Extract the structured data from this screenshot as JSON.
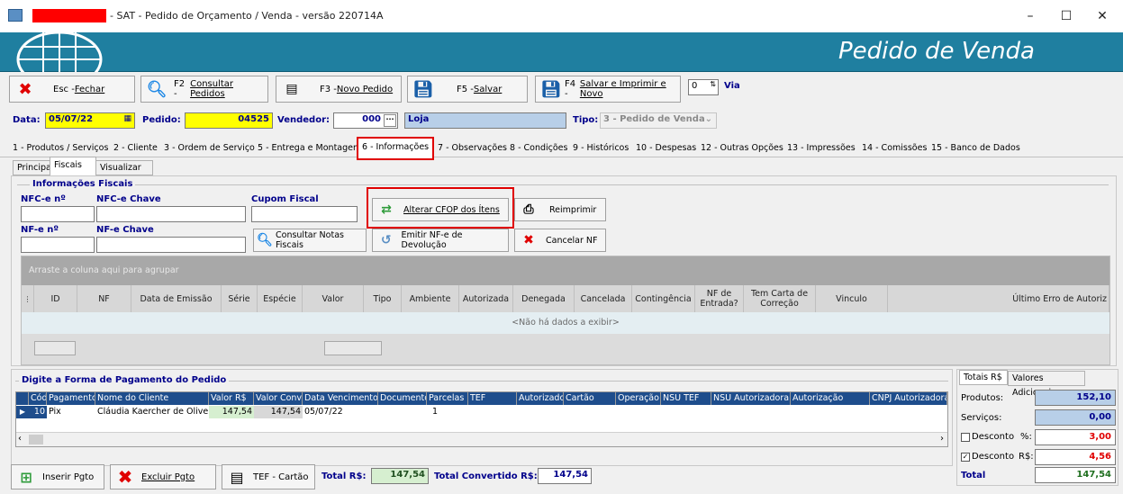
{
  "window": {
    "title": "- SAT - Pedido de Orçamento / Venda - versão 220714A",
    "controls": [
      "–",
      "☐",
      "✕"
    ]
  },
  "banner": {
    "title": "Pedido de Venda"
  },
  "toolbar": {
    "close": {
      "key": "Esc - ",
      "label": "Fechar"
    },
    "consult": {
      "key": "F2 - ",
      "label": "Consultar Pedidos"
    },
    "new": {
      "key": "F3 - ",
      "label": "Novo Pedido"
    },
    "save": {
      "key": "F5 - ",
      "label": "Salvar"
    },
    "save_print": {
      "key": "F4 - ",
      "label": "Salvar e Imprimir e Novo"
    },
    "via_value": "0",
    "via_label": "Via"
  },
  "header": {
    "data_label": "Data:",
    "data_value": "05/07/22",
    "pedido_label": "Pedido:",
    "pedido_value": "04525",
    "vendedor_label": "Vendedor:",
    "vendedor_code": "000",
    "vendedor_name": "Loja",
    "tipo_label": "Tipo:",
    "tipo_value": "3 - Pedido de Venda"
  },
  "tabs": [
    "1 - Produtos / Serviços",
    "2 - Cliente",
    "3 - Ordem de Serviço",
    "5 - Entrega e Montagem",
    "6 - Informações",
    "7 - Observações",
    "8 - Condições",
    "9 - Históricos",
    "10 - Despesas",
    "12 - Outras Opções",
    "13 - Impressões",
    "14 - Comissões",
    "15 - Banco de Dados"
  ],
  "subtabs": [
    "Principal",
    "Fiscais",
    "Visualizar XML"
  ],
  "fiscal": {
    "group_title": "Informações Fiscais",
    "nfce_num_label": "NFC-e nº",
    "nfce_key_label": "NFC-e Chave",
    "cupom_label": "Cupom Fiscal",
    "nfe_num_label": "NF-e nº",
    "nfe_key_label": "NF-e Chave",
    "btn_consult_nf": "Consultar Notas Fiscais",
    "btn_alter_cfop": "Alterar CFOP dos Ítens",
    "btn_reprint": "Reimprimir",
    "btn_devolution": "Emitir NF-e de Devolução",
    "btn_cancel_nf": "Cancelar NF"
  },
  "grid": {
    "group_hint": "Arraste a coluna aqui para agrupar",
    "columns": [
      "ID",
      "NF",
      "Data de Emissão",
      "Série",
      "Espécie",
      "Valor",
      "Tipo",
      "Ambiente",
      "Autorizada",
      "Denegada",
      "Cancelada",
      "Contingência",
      "NF de Entrada?",
      "Tem Carta de Correção",
      "Vinculo",
      "Último Erro de Autoriz"
    ],
    "empty": "<Não há dados a exibir>"
  },
  "payment": {
    "title": "Digite a Forma de Pagamento do Pedido",
    "columns": [
      "Cód",
      "Pagamento",
      "Nome do Cliente",
      "Valor R$",
      "Valor Conv",
      "Data Vencimento",
      "Documento",
      "Parcelas",
      "TEF",
      "Autorizador",
      "Cartão",
      "Operação",
      "NSU TEF",
      "NSU Autorizadora",
      "Autorização",
      "CNPJ Autorizadora"
    ],
    "row": {
      "cod": "10",
      "pagamento": "Pix",
      "nome": "Cláudia  Kaercher de Oliveira",
      "valor": "147,54",
      "valor_conv": "147,54",
      "vencimento": "05/07/22",
      "parcelas": "1"
    }
  },
  "bottom": {
    "insert": "Inserir Pgto",
    "delete": "Excluir Pgto",
    "tef": "TEF - Cartão",
    "total_label": "Total R$:",
    "total_value": "147,54",
    "total_conv_label": "Total Convertido R$:",
    "total_conv_value": "147,54"
  },
  "totals": {
    "tab1": "Totais R$",
    "tab2": "Valores Adicionais",
    "produtos_label": "Produtos:",
    "produtos_value": "152,10",
    "servicos_label": "Serviços:",
    "servicos_value": "0,00",
    "desconto_label": "Desconto",
    "pct_label": "%:",
    "pct_value": "3,00",
    "rs_label": "R$:",
    "rs_value": "4,56",
    "total_label": "Total",
    "total_value": "147,54"
  },
  "colors": {
    "banner": "#1f7fa0",
    "pedido_bg": "#ffff00",
    "vendedor_bg": "#b8cfe8",
    "highlight_red": "#e00000"
  }
}
